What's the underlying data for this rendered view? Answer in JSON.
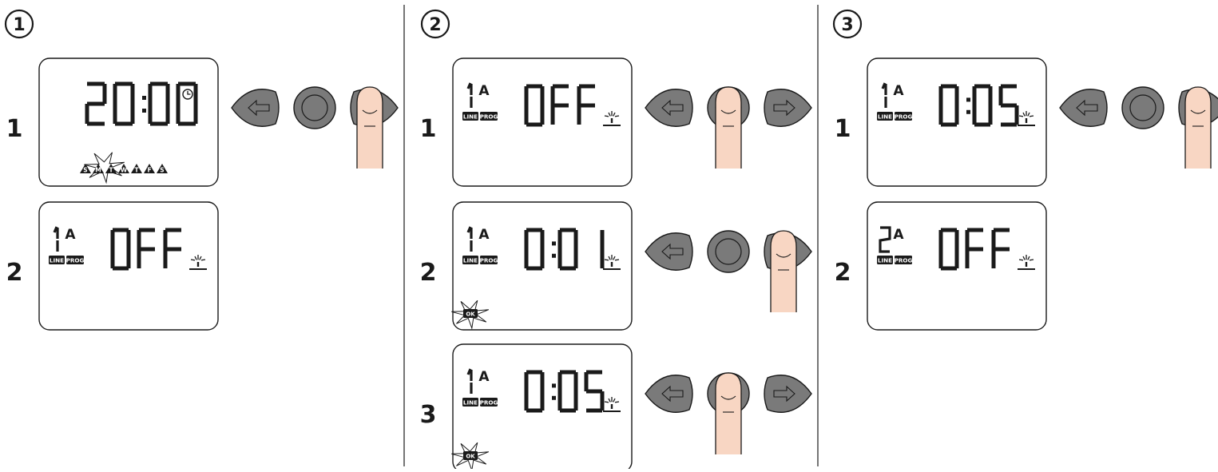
{
  "colors": {
    "ink": "#1a1a1a",
    "button_fill": "#7a7a7a",
    "finger_fill": "#f8d6c3",
    "badge_fill": "#1a1a1a",
    "badge_text": "#ffffff"
  },
  "step_badges": [
    "1",
    "2",
    "3"
  ],
  "icons": {
    "left_arrow": "left-arrow-button-icon",
    "right_arrow": "right-arrow-button-icon",
    "ok_round": "round-ok-button-icon",
    "finger_press": "finger-press-icon",
    "clock": "clock-icon",
    "sprinkler": "sprinkler-icon",
    "burst": "flash-burst-icon"
  },
  "columns": [
    {
      "step": "1",
      "rows": [
        {
          "number": "1",
          "display": {
            "digits": "20:00",
            "line_digit": "",
            "prog_letter": "",
            "show_line_prog": false,
            "show_clock": true,
            "show_sprinkler": false,
            "show_ok_flash": false,
            "show_days": true
          },
          "days": [
            "S",
            "M",
            "T",
            "W",
            "T",
            "F",
            "S"
          ],
          "buttons": [
            "left",
            "ok",
            "right"
          ],
          "pressed": "right"
        },
        {
          "number": "2",
          "display": {
            "digits": "OFF",
            "line_digit": "1",
            "prog_letter": "A",
            "show_line_prog": true,
            "show_clock": false,
            "show_sprinkler": true,
            "show_ok_flash": false,
            "show_days": false
          },
          "days": [],
          "buttons": [],
          "pressed": ""
        }
      ]
    },
    {
      "step": "2",
      "rows": [
        {
          "number": "1",
          "display": {
            "digits": "OFF",
            "line_digit": "1",
            "prog_letter": "A",
            "show_line_prog": true,
            "show_clock": false,
            "show_sprinkler": true,
            "show_ok_flash": false,
            "show_days": false
          },
          "days": [],
          "buttons": [
            "left",
            "ok",
            "right"
          ],
          "pressed": "ok"
        },
        {
          "number": "2",
          "display": {
            "digits": "0:01",
            "line_digit": "1",
            "prog_letter": "A",
            "show_line_prog": true,
            "show_clock": false,
            "show_sprinkler": true,
            "show_ok_flash": true,
            "show_days": false
          },
          "days": [],
          "buttons": [
            "left",
            "ok",
            "right"
          ],
          "pressed": "right"
        },
        {
          "number": "3",
          "display": {
            "digits": "0:05",
            "line_digit": "1",
            "prog_letter": "A",
            "show_line_prog": true,
            "show_clock": false,
            "show_sprinkler": true,
            "show_ok_flash": true,
            "show_days": false
          },
          "days": [],
          "buttons": [
            "left",
            "ok",
            "right"
          ],
          "pressed": "ok"
        }
      ]
    },
    {
      "step": "3",
      "rows": [
        {
          "number": "1",
          "display": {
            "digits": "0:05",
            "line_digit": "1",
            "prog_letter": "A",
            "show_line_prog": true,
            "show_clock": false,
            "show_sprinkler": true,
            "show_ok_flash": false,
            "show_days": false
          },
          "days": [],
          "buttons": [
            "left",
            "ok",
            "right"
          ],
          "pressed": "right"
        },
        {
          "number": "2",
          "display": {
            "digits": "OFF",
            "line_digit": "2",
            "prog_letter": "A",
            "show_line_prog": true,
            "show_clock": false,
            "show_sprinkler": true,
            "show_ok_flash": false,
            "show_days": false
          },
          "days": [],
          "buttons": [],
          "pressed": ""
        }
      ]
    }
  ],
  "labels": {
    "line_tag": "LINE",
    "prog_tag": "PROG",
    "ok_tag": "OK"
  }
}
